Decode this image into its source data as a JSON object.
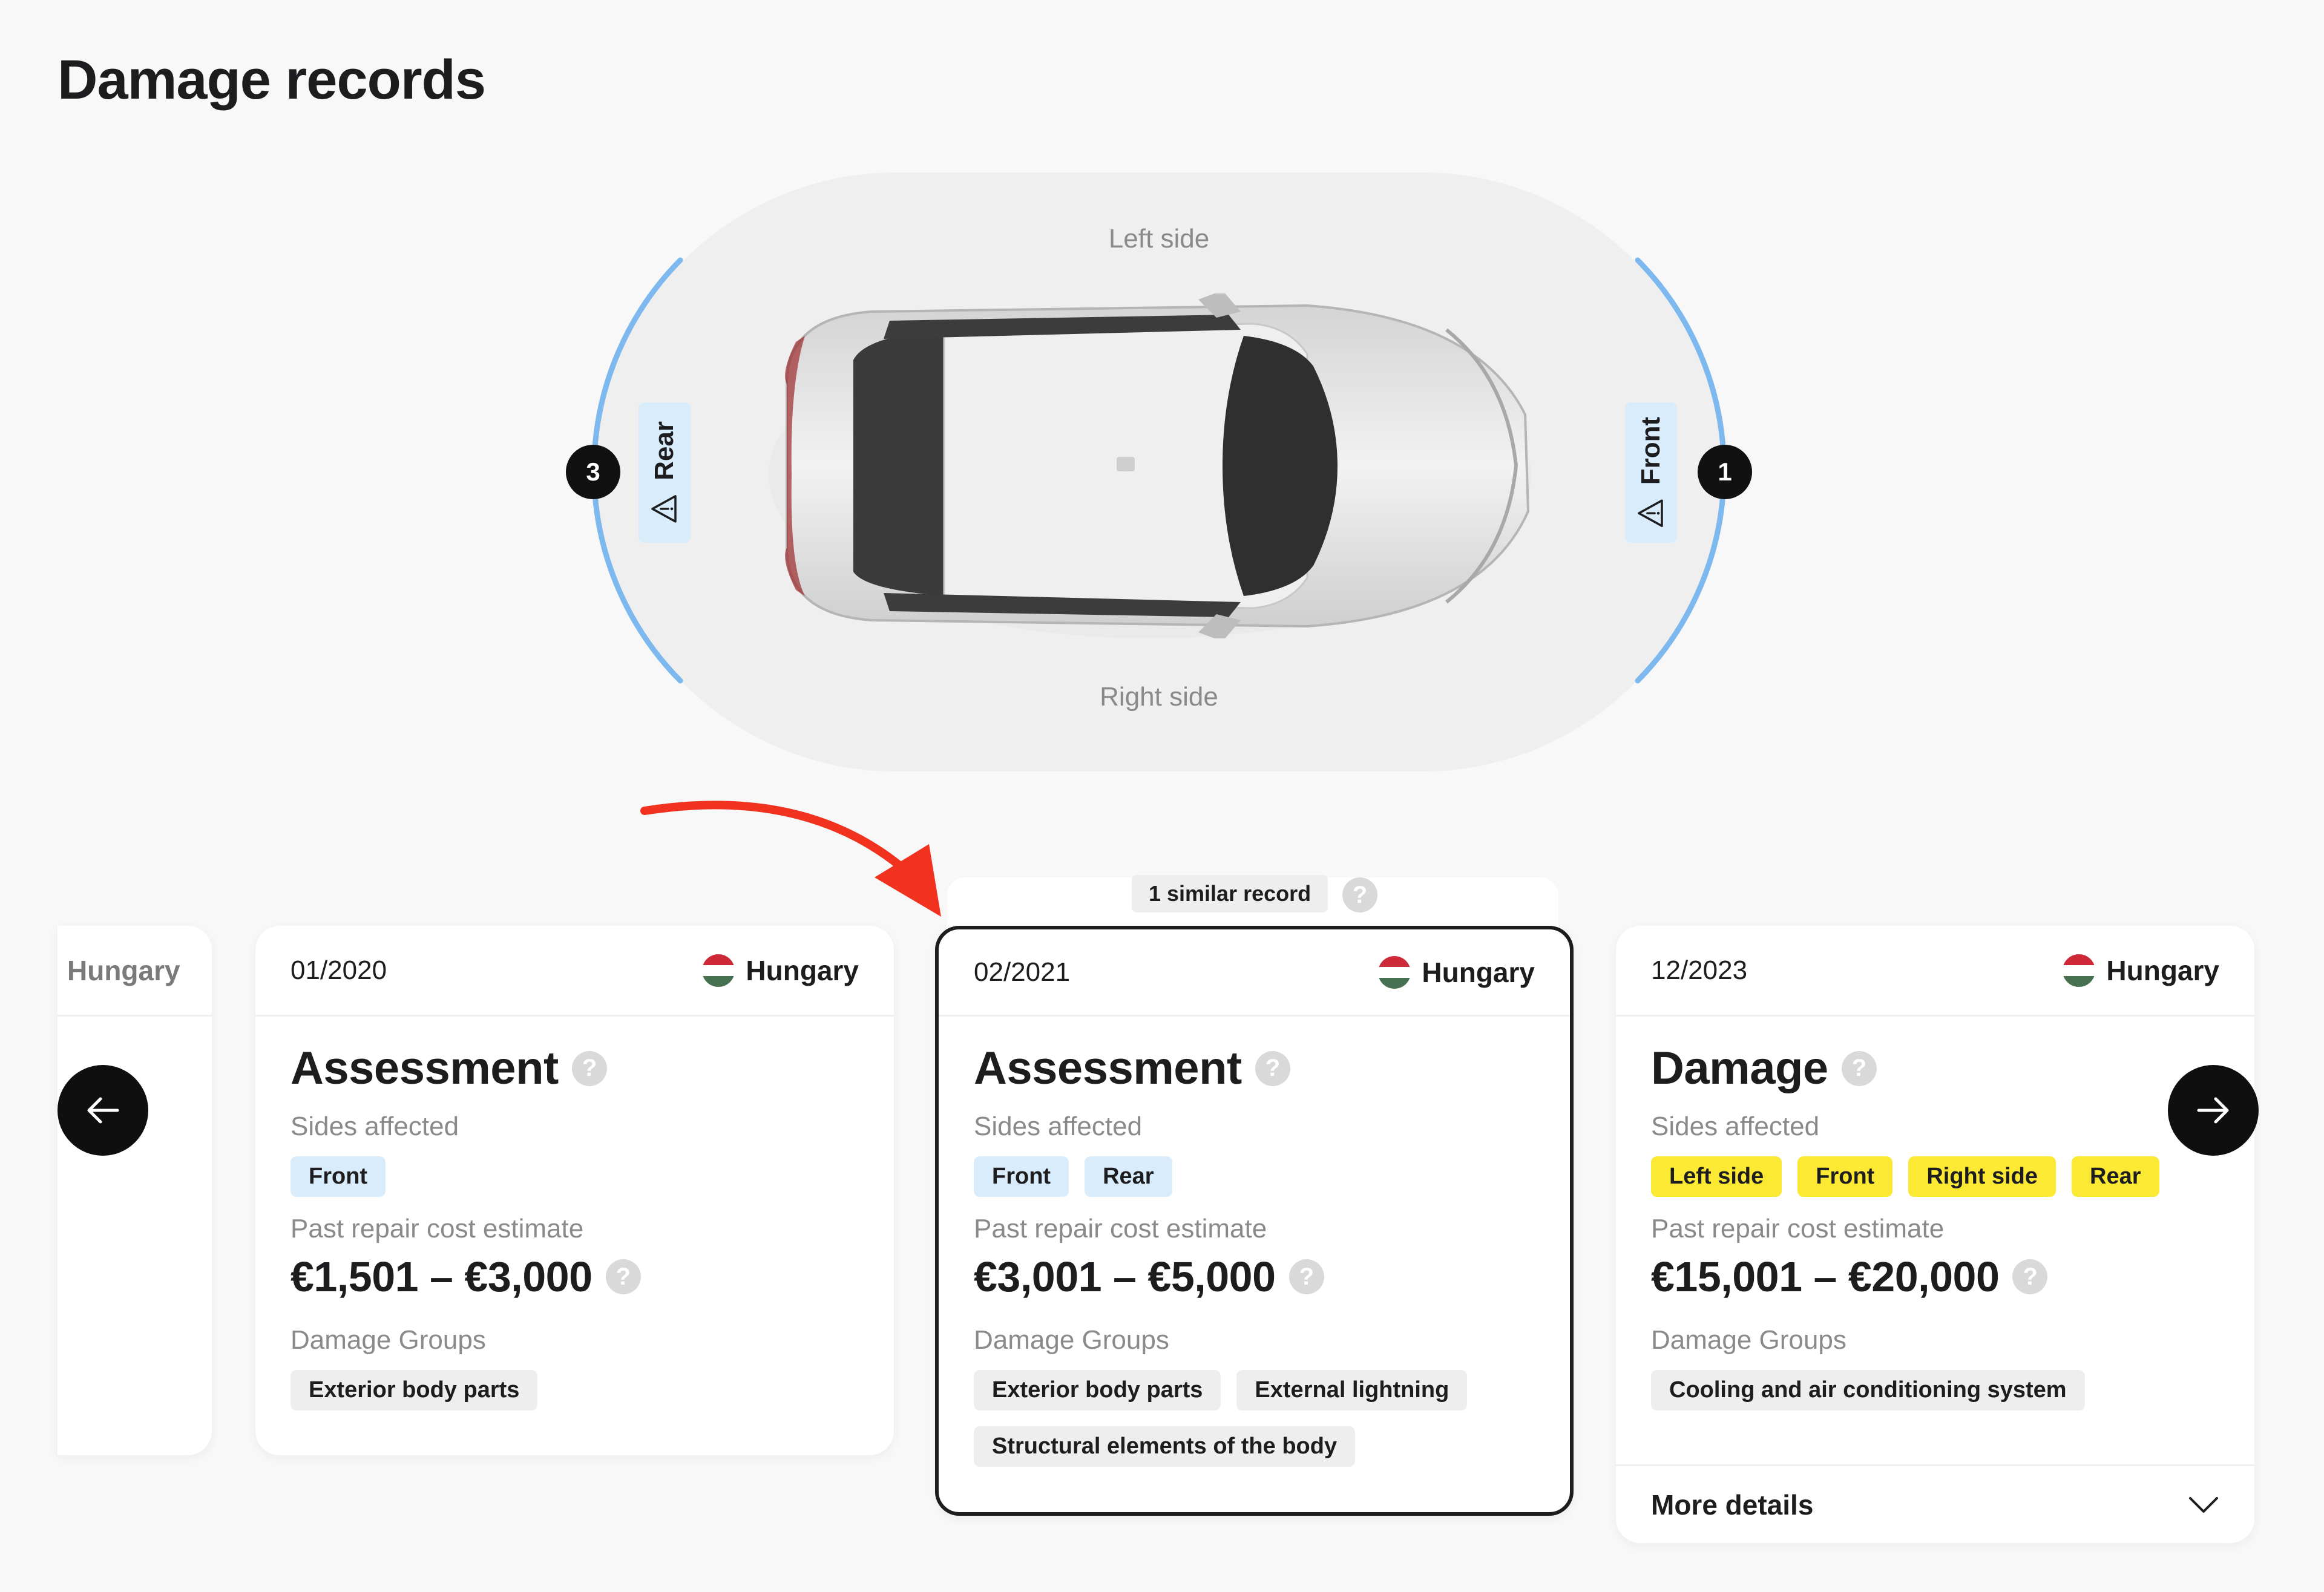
{
  "page": {
    "title": "Damage records"
  },
  "diagram": {
    "left_side_label": "Left side",
    "right_side_label": "Right side",
    "rear": {
      "label": "Rear",
      "count": "3",
      "icon": "warning-icon"
    },
    "front": {
      "label": "Front",
      "count": "1",
      "icon": "warning-icon"
    },
    "arc_color": "#7db8ee"
  },
  "similar": {
    "label": "1 similar record",
    "help": "?"
  },
  "partial_card": {
    "country": "Hungary"
  },
  "cards": [
    {
      "date": "01/2020",
      "country": "Hungary",
      "type": "Assessment",
      "sides_label": "Sides affected",
      "sides": [
        "Front"
      ],
      "cost_label": "Past repair cost estimate",
      "cost": "€1,501 – €3,000",
      "groups_label": "Damage Groups",
      "groups": [
        "Exterior body parts"
      ],
      "tag_color": "blue"
    },
    {
      "date": "02/2021",
      "country": "Hungary",
      "type": "Assessment",
      "sides_label": "Sides affected",
      "sides": [
        "Front",
        "Rear"
      ],
      "cost_label": "Past repair cost estimate",
      "cost": "€3,001 – €5,000",
      "groups_label": "Damage Groups",
      "groups": [
        "Exterior body parts",
        "External lightning",
        "Structural elements of the body"
      ],
      "tag_color": "blue",
      "highlighted": true
    },
    {
      "date": "12/2023",
      "country": "Hungary",
      "type": "Damage",
      "sides_label": "Sides affected",
      "sides": [
        "Left side",
        "Front",
        "Right side",
        "Rear"
      ],
      "cost_label": "Past repair cost estimate",
      "cost": "€15,001 – €20,000",
      "groups_label": "Damage Groups",
      "groups": [
        "Cooling and air conditioning system"
      ],
      "tag_color": "yellow",
      "more_details": "More details"
    }
  ],
  "help_glyph": "?",
  "colors": {
    "highlight_border": "#1d1d1f",
    "arrow": "#f0321e",
    "side_blue": "#d8ecfb",
    "side_yellow": "#fbe934"
  }
}
